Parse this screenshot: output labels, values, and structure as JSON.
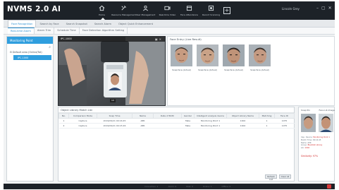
{
  "app": {
    "title": "NVMS 2.0 AI"
  },
  "modules": [
    {
      "label": "Home",
      "icon": "home-icon",
      "active": true
    },
    {
      "label": "Resource Management",
      "icon": "resource-icon"
    },
    {
      "label": "User Management",
      "icon": "users-icon"
    },
    {
      "label": "Real-time Video",
      "icon": "video-icon"
    },
    {
      "label": "Face Attendance",
      "icon": "calendar-icon"
    },
    {
      "label": "Record Scanning",
      "icon": "record-icon"
    }
  ],
  "header": {
    "user": "Lincoln Grey",
    "add_label": "+",
    "min_label": "–",
    "max_label": "▢",
    "close_label": "✕"
  },
  "tabs_primary": [
    {
      "label": "Face Recognition",
      "active": true
    },
    {
      "label": "Search by Face"
    },
    {
      "label": "Search Snapshot"
    },
    {
      "label": "Search Alarm"
    },
    {
      "label": "Object Quick Enhancement"
    }
  ],
  "tabs_secondary": [
    {
      "label": "Real-time Alarm",
      "active": true
    },
    {
      "label": "Alarm Trim"
    },
    {
      "label": "Schedule Time"
    },
    {
      "label": "Face Detection Algorithm Setting"
    }
  ],
  "left_panel": {
    "title": "Monitoring Point",
    "tree_root": "Default area (Online/Tot)",
    "tree_child": "IPC-1000"
  },
  "video": {
    "channel": "IPC-1000",
    "badge": "1X"
  },
  "face_panel": {
    "title": "Face Entry (Live Result)",
    "faces": [
      {
        "label": "Snap face (Actual)"
      },
      {
        "label": "Snap face (Actual)"
      },
      {
        "label": "Snap face (Actual)"
      },
      {
        "label": "Snap face (Actual)"
      }
    ]
  },
  "table": {
    "title": "Object Library Match List",
    "columns": [
      "No.",
      "Comparison Mode",
      "Snap Time",
      "Name",
      "Date of Birth",
      "Gender",
      "Intelligent analysis device",
      "Object Library Name",
      "Matching",
      "Face ID"
    ],
    "rows": [
      [
        "1",
        "Capture",
        "2019/09/21 09:16:45",
        "AER",
        "",
        "Male",
        "Monitoring Point 1",
        "1002",
        "1",
        "1075"
      ],
      [
        "2",
        "Capture",
        "2019/09/21 09:15:26",
        "AER",
        "",
        "Male",
        "Monitoring Point 1",
        "1002",
        "1",
        "1075"
      ]
    ],
    "buttons": {
      "refresh": "Refresh List",
      "clear": "Clear All"
    }
  },
  "detail": {
    "label_left": "Snap Pix",
    "label_right": "Face Lib Image",
    "lines": [
      {
        "key": "Cap. Device:",
        "value": "Monitoring Point 1"
      },
      {
        "key": "Match Time:",
        "value": "09:16:45"
      },
      {
        "key": "Name:",
        "value": "AER"
      },
      {
        "key": "Group:",
        "value": "Blacklist Library"
      },
      {
        "key": "Lib:",
        "value": "1002"
      }
    ],
    "similarity_label": "Similarity:",
    "similarity_value": "97%"
  },
  "statusbar": {
    "items": [
      "Connection: 1",
      "Alarm: 0",
      "Disk: 0",
      "Online: 1",
      "Offline: 0"
    ]
  },
  "colors": {
    "accent": "#2f9ede",
    "topbar": "#1d2228",
    "alert": "#d83a3a"
  }
}
